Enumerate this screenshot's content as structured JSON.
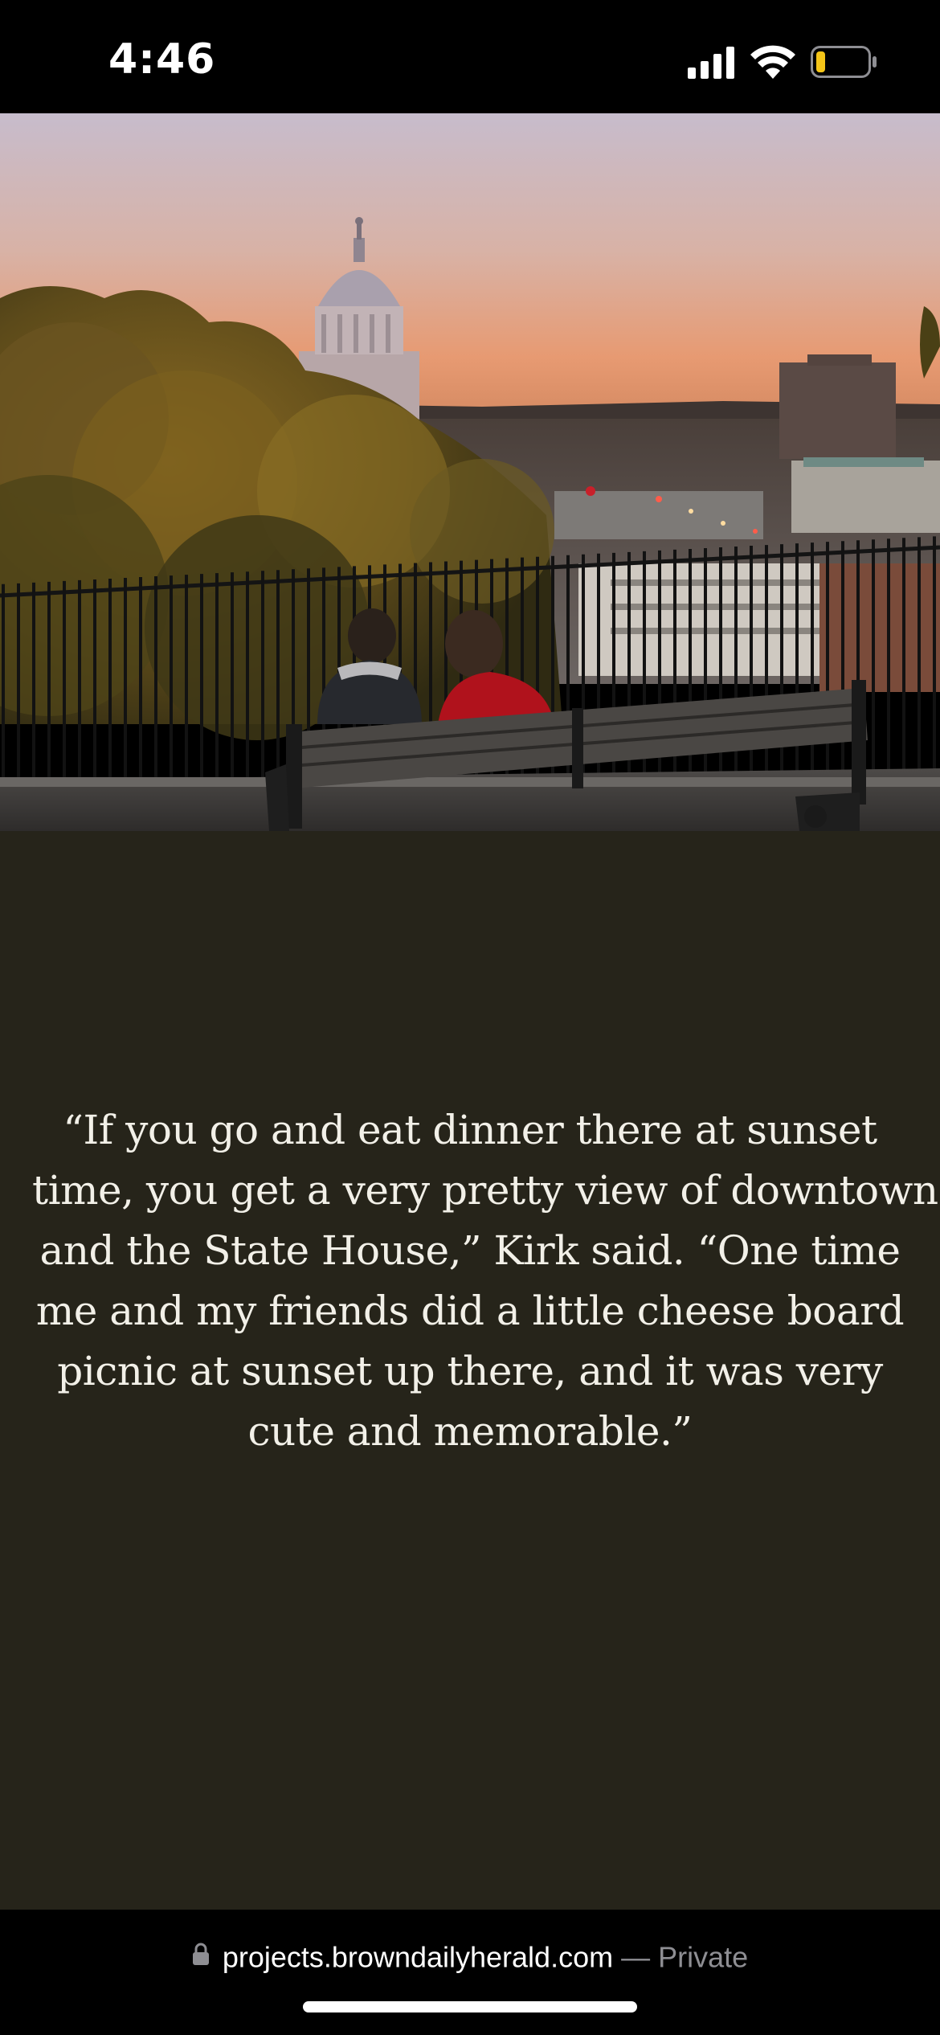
{
  "status_bar": {
    "time": "4:46",
    "icons": [
      "cellular-signal-icon",
      "wifi-icon",
      "battery-low-icon"
    ],
    "battery_color": "#f5c518"
  },
  "photo": {
    "description_icon": "state-house-sunset-photo"
  },
  "quote": {
    "lines": [
      "“If you go and eat dinner there at sunset",
      "time, you get a very pretty view of downtown",
      "and the State House,” Kirk said. “One time",
      "me and my friends did a little cheese board",
      "picnic at sunset up there, and it was very",
      "cute and memorable.”"
    ]
  },
  "url_bar": {
    "domain": "projects.browndailyherald.com",
    "separator": " — Private",
    "icon": "lock-icon"
  },
  "colors": {
    "panel_bg": "#26241a",
    "quote_text": "#f2f0e8",
    "chrome_bg": "#000000"
  }
}
